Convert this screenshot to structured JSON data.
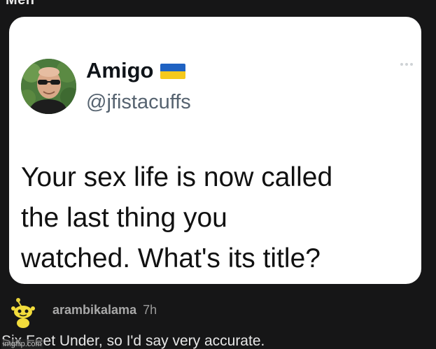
{
  "top_label": "Meh",
  "tweet": {
    "display_name": "Amigo",
    "flag": {
      "top_color": "#1f62c2",
      "bottom_color": "#f5c91c"
    },
    "handle": "@jfistacuffs",
    "text_lines": [
      "Your sex life is now called",
      "the last thing you",
      "watched. What's its title?"
    ]
  },
  "comment": {
    "username": "arambikalama",
    "time": "7h",
    "body": "Six Feet Under, so I'd say very accurate."
  },
  "watermark": "imgflip.com"
}
